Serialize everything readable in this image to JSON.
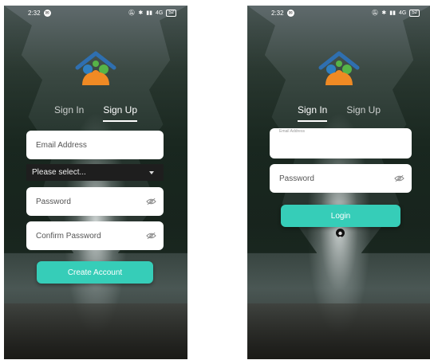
{
  "status_bar": {
    "time": "2:32",
    "notification_glyph": "✉",
    "network_text": "4G",
    "battery_text": "52"
  },
  "signup_screen": {
    "tabs": {
      "sign_in": "Sign In",
      "sign_up": "Sign Up",
      "active": "sign_up"
    },
    "email": {
      "placeholder": "Email Address"
    },
    "select": {
      "value": "Please select..."
    },
    "password": {
      "placeholder": "Password"
    },
    "confirm_password": {
      "placeholder": "Confirm Password"
    },
    "create_button": "Create Account"
  },
  "signin_screen": {
    "tabs": {
      "sign_in": "Sign In",
      "sign_up": "Sign Up",
      "active": "sign_in"
    },
    "email": {
      "floating_label": "Email Address"
    },
    "password": {
      "placeholder": "Password"
    },
    "login_button": "Login"
  },
  "icons": [
    "family-logo-icon",
    "eye-off-icon",
    "chevron-down-icon",
    "user-avatar-icon",
    "mute-icon",
    "bluetooth-icon",
    "signal-icon",
    "battery-icon"
  ],
  "colors": {
    "accent": "#36cdb8",
    "logo_blue": "#2f7fc1",
    "logo_orange": "#f08a24",
    "logo_green": "#56b447",
    "logo_roof": "#2f6fb0"
  }
}
